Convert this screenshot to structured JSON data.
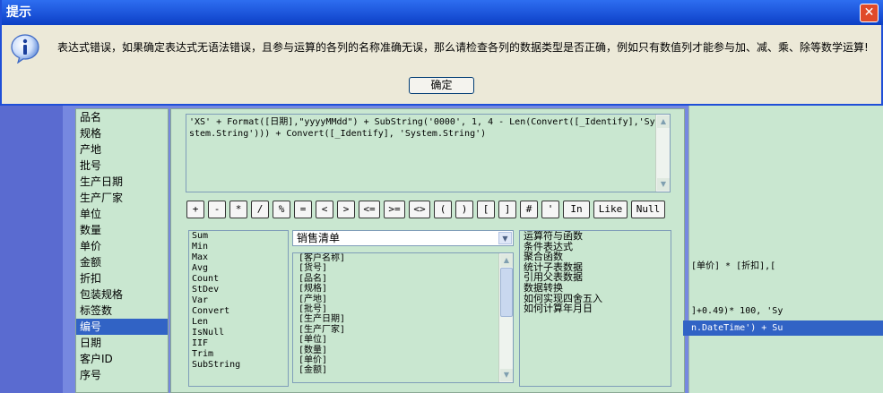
{
  "dialog": {
    "title": "提示",
    "message": "表达式错误，如果确定表达式无语法错误，且参与运算的各列的名称准确无误，那么请检查各列的数据类型是否正确，例如只有数值列才能参与加、减、乘、除等数学运算!",
    "ok_label": "确定",
    "icon": "info-icon",
    "close_icon": "close-icon"
  },
  "field_list": {
    "items": [
      "品名",
      "规格",
      "产地",
      "批号",
      "生产日期",
      "生产厂家",
      "单位",
      "数量",
      "单价",
      "金额",
      "折扣",
      "包装规格",
      "标签数",
      "编号",
      "日期",
      "客户ID",
      "序号"
    ],
    "selected": "编号"
  },
  "expression": {
    "text": "'XS' + Format([日期],\"yyyyMMdd\") + SubString('0000', 1, 4 - Len(Convert([_Identify],'System.String'))) + Convert([_Identify], 'System.String')"
  },
  "operators": [
    "+",
    "-",
    "*",
    "/",
    "%",
    "=",
    "<",
    ">",
    "<=",
    ">=",
    "<>",
    "(",
    ")",
    "[",
    "]",
    "#",
    "'",
    "In",
    "Like",
    "Null"
  ],
  "functions": [
    "Sum",
    "Min",
    "Max",
    "Avg",
    "Count",
    "StDev",
    "Var",
    "Convert",
    "Len",
    "IsNull",
    "IIF",
    "Trim",
    "SubString"
  ],
  "table_select": {
    "value": "销售清单"
  },
  "columns": [
    "[客户名称]",
    "[货号]",
    "[品名]",
    "[规格]",
    "[产地]",
    "[批号]",
    "[生产日期]",
    "[生产厂家]",
    "[单位]",
    "[数量]",
    "[单价]",
    "[金额]"
  ],
  "categories": [
    "运算符与函数",
    "条件表达式",
    "聚合函数",
    "统计子表数据",
    "引用父表数据",
    "数据转换",
    "如何实现四舍五入",
    "如何计算年月日"
  ],
  "side_snippets": {
    "line1": "[单价] * [折扣],[",
    "line2": "]+0.49)* 100, 'Sy",
    "line3": "n.DateTime') + Su"
  },
  "colors": {
    "title_bar": "#1a52d8",
    "dialog_bg": "#ece9d8",
    "panel_bg": "#c9e7d0",
    "selection": "#3163c5"
  }
}
